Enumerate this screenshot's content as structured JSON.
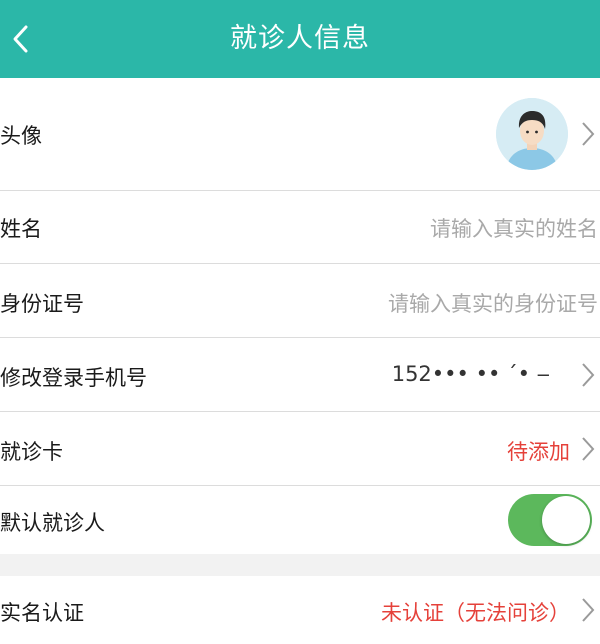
{
  "header": {
    "title": "就诊人信息",
    "back_icon": "chevron-left-icon",
    "color": "#2bb7a8"
  },
  "rows": {
    "avatar": {
      "label": "头像"
    },
    "name": {
      "label": "姓名",
      "placeholder": "请输入真实的姓名"
    },
    "id_card": {
      "label": "身份证号",
      "placeholder": "请输入真实的身份证号"
    },
    "phone": {
      "label": "修改登录手机号",
      "value": "152••• •• ˊ• ‒"
    },
    "card": {
      "label": "就诊卡",
      "value": "待添加"
    },
    "default_patient": {
      "label": "默认就诊人",
      "toggle_on": true
    },
    "real_name": {
      "label": "实名认证",
      "value": "未认证（无法问诊）"
    }
  },
  "colors": {
    "accent_red": "#e5413a",
    "toggle_green": "#5cb85c",
    "placeholder_gray": "#a9a9a9"
  }
}
